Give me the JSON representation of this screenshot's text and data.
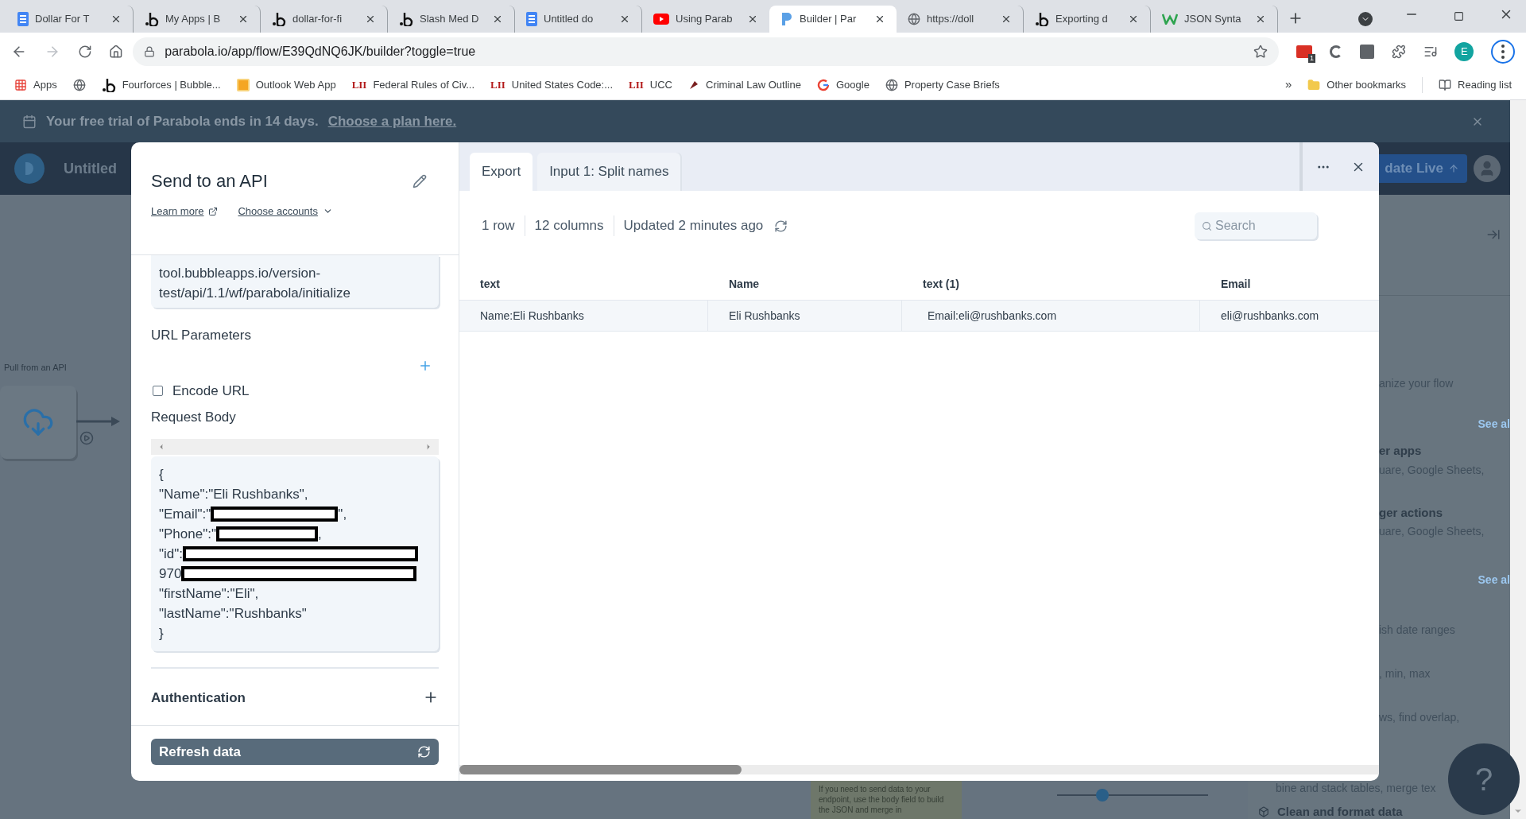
{
  "browser": {
    "tabs": [
      {
        "title": "Dollar For T",
        "selected": false
      },
      {
        "title": "My Apps | B",
        "selected": false
      },
      {
        "title": "dollar-for-fi",
        "selected": false
      },
      {
        "title": "Slash Med D",
        "selected": false
      },
      {
        "title": "Untitled do",
        "selected": false
      },
      {
        "title": "Using Parab",
        "selected": false
      },
      {
        "title": "Builder | Par",
        "selected": true
      },
      {
        "title": "https://doll",
        "selected": false
      },
      {
        "title": "Exporting d",
        "selected": false
      },
      {
        "title": "JSON Synta",
        "selected": false
      }
    ],
    "url": "parabola.io/app/flow/E39QdNQ6JK/builder?toggle=true",
    "extension_badge": "1",
    "profile_initial": "E",
    "bookmarks": [
      {
        "label": "Apps"
      },
      {
        "label": "Fourforces | Bubble..."
      },
      {
        "label": "Outlook Web App"
      },
      {
        "label": "Federal Rules of Civ...",
        "badge": "LII"
      },
      {
        "label": "United States Code:...",
        "badge": "LII"
      },
      {
        "label": "UCC",
        "badge": "LII"
      },
      {
        "label": "Criminal Law Outline"
      },
      {
        "label": "Google"
      },
      {
        "label": "Property Case Briefs"
      }
    ],
    "bookmarks_more": "»",
    "other_bookmarks": "Other bookmarks",
    "reading_list": "Reading list"
  },
  "trial_banner": {
    "text": "Your free trial of Parabola ends in 14 days.",
    "link": "Choose a plan here."
  },
  "app_header": {
    "flow_title": "Untitled",
    "publish_button": "date Live"
  },
  "canvas": {
    "node_label": "Pull from an API",
    "note": "If you need to send data to your endpoint, use the body field to build the JSON and merge in",
    "slider": {
      "level": 0.3
    }
  },
  "sidebar": {
    "items": [
      {
        "kind": "desc",
        "text": "anize your flow"
      },
      {
        "kind": "link",
        "text": "See al"
      },
      {
        "kind": "title",
        "text": "er apps"
      },
      {
        "kind": "desc",
        "text": "uare, Google Sheets,"
      },
      {
        "kind": "title",
        "text": "ger actions"
      },
      {
        "kind": "desc",
        "text": "uare, Google Sheets,"
      },
      {
        "kind": "link",
        "text": "See al"
      },
      {
        "kind": "desc",
        "text": "ish date ranges"
      },
      {
        "kind": "desc",
        "text": ", min, max"
      },
      {
        "kind": "desc",
        "text": "ws, find overlap,"
      }
    ],
    "bottom_items": [
      {
        "kind": "desc",
        "text": "bine and stack tables, merge tex"
      },
      {
        "kind": "title",
        "text": "Clean and format data"
      }
    ],
    "help_button": "?"
  },
  "modal": {
    "left": {
      "title": "Send to an API",
      "learn_more": "Learn more",
      "choose_accounts": "Choose accounts",
      "url_lines": [
        "tool.bubbleapps.io/version-",
        "test/api/1.1/wf/parabola/initialize"
      ],
      "url_parameters_label": "URL Parameters",
      "encode_url": {
        "label": "Encode URL",
        "checked": false
      },
      "request_body_label": "Request Body",
      "body_lines": [
        {
          "text": "{",
          "redacted": false
        },
        {
          "text": "\"Name\":\"Eli Rushbanks\",",
          "redacted": false
        },
        {
          "text": "\"Email\":\"",
          "redacted": true,
          "after": "\","
        },
        {
          "text": "\"Phone\":\"",
          "redacted": true,
          "after": ","
        },
        {
          "text": "\"id\":",
          "redacted": true
        },
        {
          "text": "970",
          "redacted": true
        },
        {
          "text": "\"firstName\":\"Eli\",",
          "redacted": false
        },
        {
          "text": "\"lastName\":\"Rushbanks\"",
          "redacted": false
        },
        {
          "text": "}",
          "redacted": false
        }
      ],
      "authentication_label": "Authentication",
      "refresh_button": "Refresh data"
    },
    "right": {
      "tabs": [
        {
          "label": "Export",
          "selected": true
        },
        {
          "label": "Input 1: Split names",
          "selected": false
        }
      ],
      "stats": [
        "1 row",
        "12 columns",
        "Updated 2 minutes ago"
      ],
      "search_placeholder": "Search",
      "table": {
        "columns": [
          "text",
          "Name",
          "text (1)",
          "Email"
        ],
        "rows": [
          [
            "Name:Eli Rushbanks",
            "Eli Rushbanks",
            "Email:eli@rushbanks.com",
            "eli@rushbanks.com"
          ]
        ]
      }
    }
  }
}
